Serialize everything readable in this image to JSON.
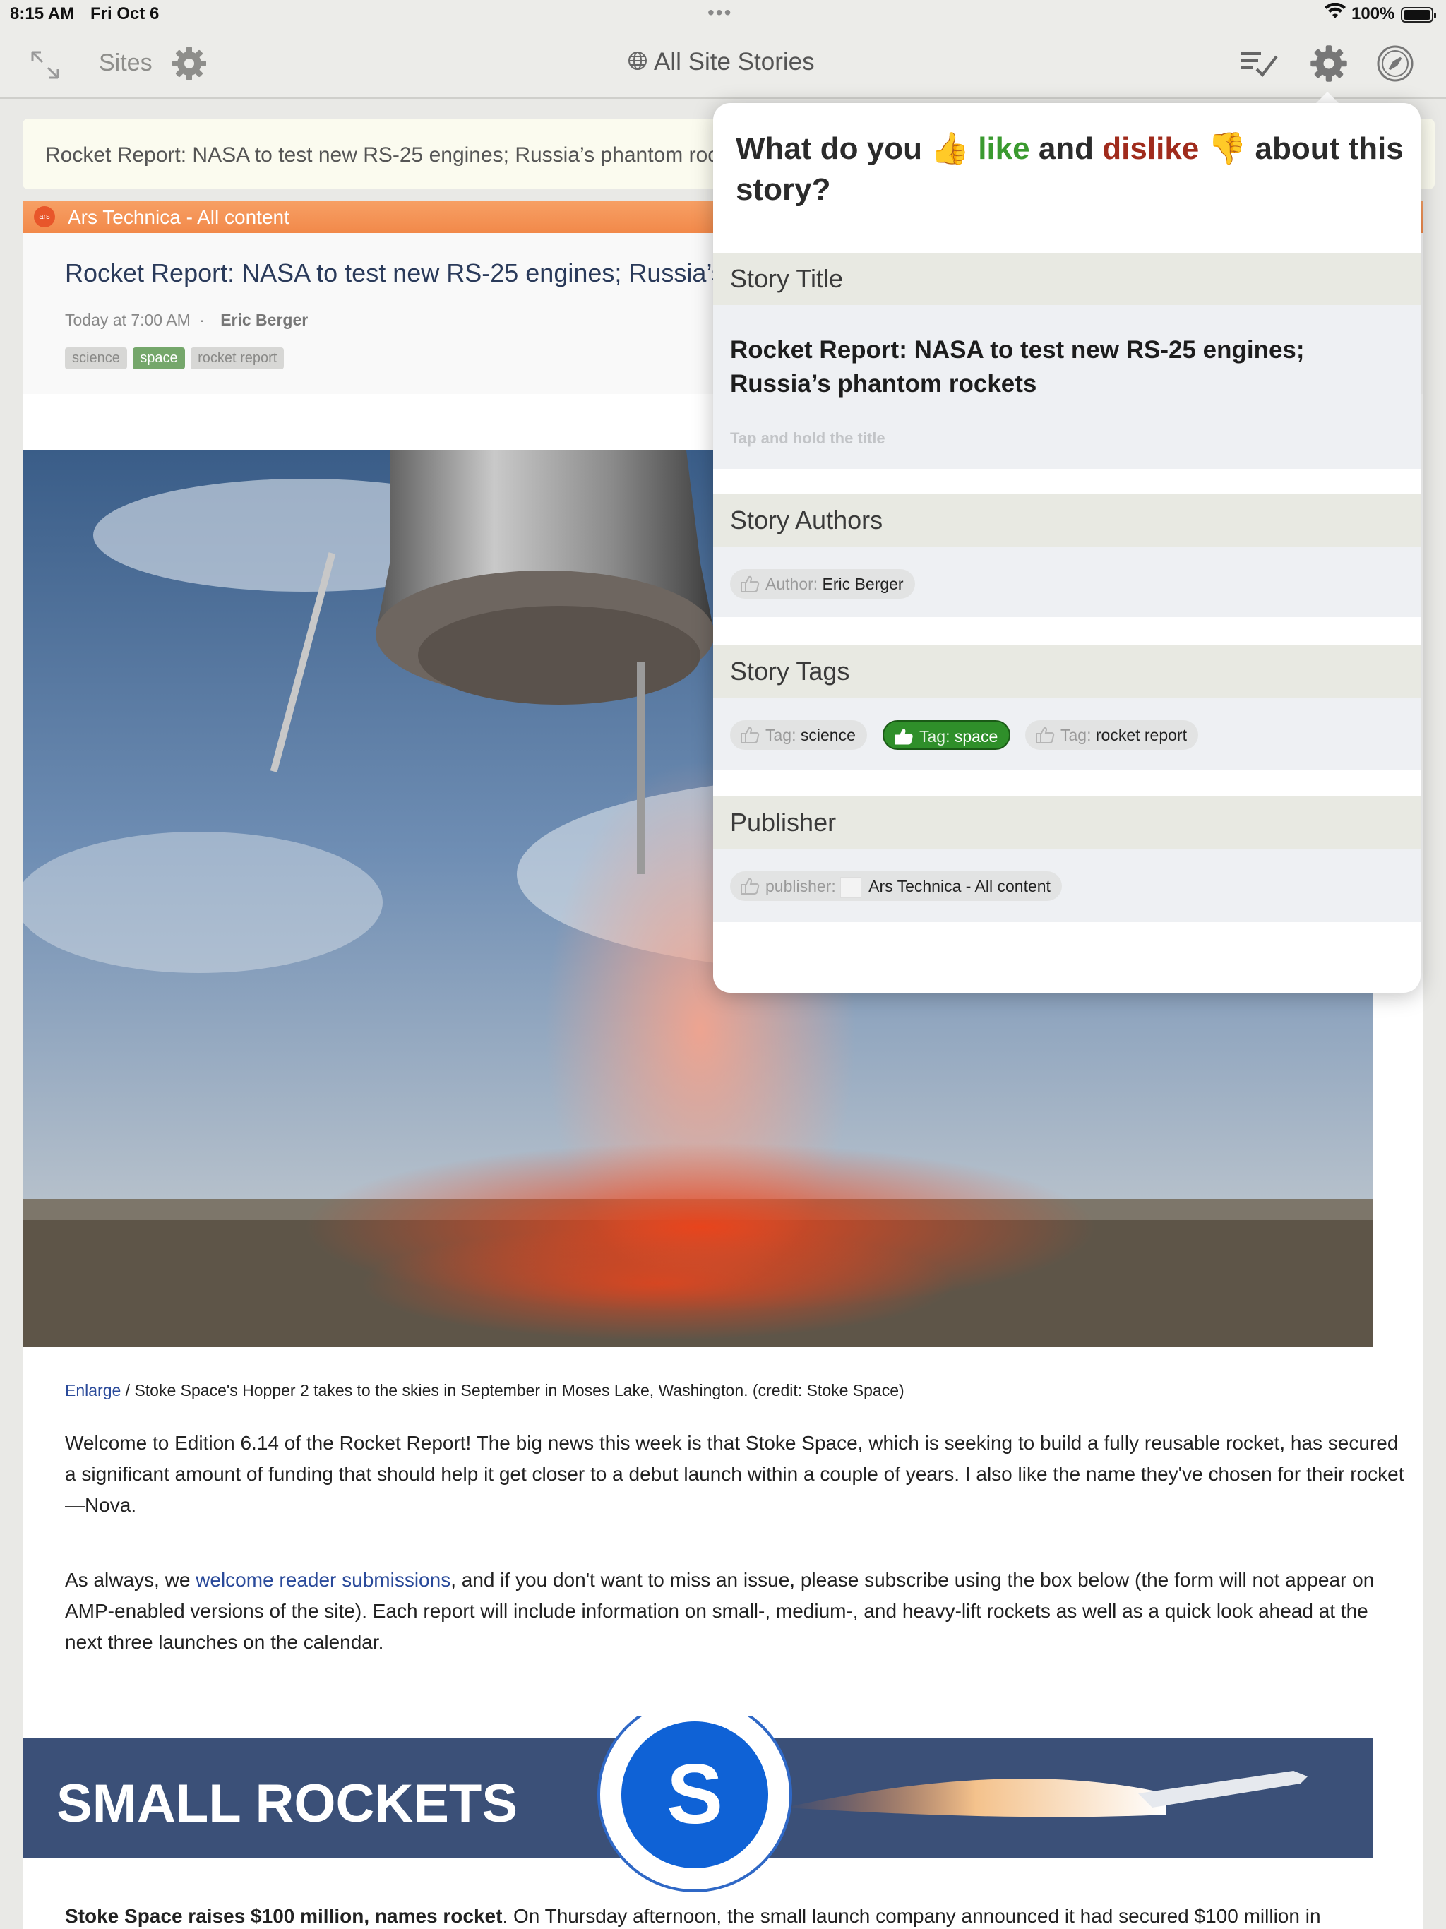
{
  "status_bar": {
    "time": "8:15 AM",
    "date": "Fri Oct 6",
    "dots": "•••",
    "battery": "100%"
  },
  "nav": {
    "sites_label": "Sites",
    "title": "All Site Stories",
    "icons": [
      "expand-icon",
      "gear-icon",
      "globe-icon",
      "mark-read-icon",
      "gear-icon",
      "compass-icon"
    ]
  },
  "story_row": {
    "title": "Rocket Report: NASA to test new RS-25 engines; Russia’s phantom roc"
  },
  "feed": {
    "favicon_text": "ars",
    "name": "Ars Technica - All content",
    "color": "#f2894a"
  },
  "article": {
    "title": "Rocket Report: NASA to test new RS-25 engines; Russia’s ph",
    "date": "Today at 7:00 AM",
    "separator": "·",
    "author": "Eric Berger",
    "tags": [
      "science",
      "space",
      "rocket report"
    ],
    "caption_link": "Enlarge",
    "caption_text": " / Stoke Space's Hopper 2 takes to the skies in September in Moses Lake, Washington. (credit: Stoke Space)",
    "para1": "Welcome to Edition 6.14 of the Rocket Report! The big news this week is that Stoke Space, which is seeking to build a fully reusable rocket, has secured a significant amount of funding that should help it get closer to a debut launch within a couple of years. I also like the name they've chosen for their rocket—Nova.",
    "para2_before": "As always, we ",
    "para2_link": "welcome reader submissions",
    "para2_after": ", and if you don't want to miss an issue, please subscribe using the box below (the form will not appear on AMP-enabled versions of the site). Each report will include information on small-, medium-, and heavy-lift rockets as well as a quick look ahead at the next three launches on the calendar.",
    "banner_text": "SMALL ROCKETS",
    "banner_logo": "S",
    "bottom_bold": "Stoke Space raises $100 million, names rocket",
    "bottom_rest": ". On Thursday afternoon, the small launch company announced it had secured $100 million in"
  },
  "popover": {
    "q_part1": "What do you ",
    "q_like_emoji": "👍",
    "q_like": "like",
    "q_and": " and ",
    "q_dislike": "dislike",
    "q_dislike_emoji": "👎",
    "q_part2": " about this story?",
    "title_header": "Story Title",
    "story_title": "Rocket Report: NASA to test new RS-25 engines; Russia’s phantom rockets",
    "title_hint": "Tap and hold the title",
    "authors_header": "Story Authors",
    "author_label": "Author:",
    "author_value": "Eric Berger",
    "tags_header": "Story Tags",
    "tag_label": "Tag:",
    "tag_values": [
      "science",
      "space",
      "rocket report"
    ],
    "publisher_header": "Publisher",
    "publisher_label": "publisher:",
    "publisher_value": "Ars Technica - All content"
  }
}
